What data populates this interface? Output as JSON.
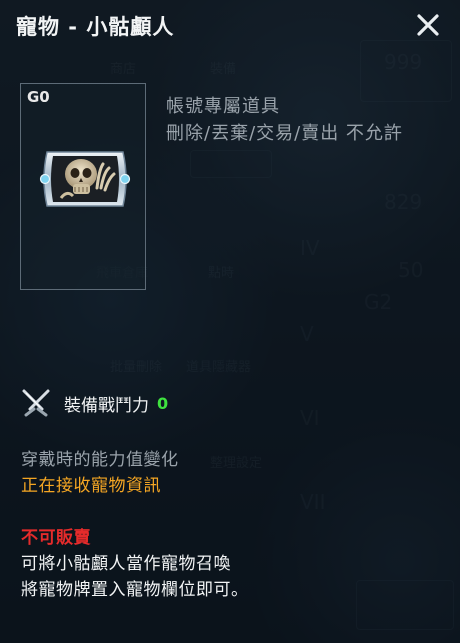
{
  "window": {
    "title": "寵物 - 小骷顱人",
    "close_icon": "close-icon"
  },
  "item": {
    "grade": "G0",
    "icon": "skull-pet-card-icon",
    "account_lines": [
      "帳號專屬道具",
      "刪除/丟棄/交易/賣出 不允許"
    ]
  },
  "stats": {
    "power_icon": "crossed-swords-icon",
    "power_label": "裝備戰鬥力",
    "power_value": "0"
  },
  "ability": {
    "title": "穿戴時的能力值變化",
    "status": "正在接收寵物資訊"
  },
  "notes": {
    "not_sellable": "不可販賣",
    "desc_lines": [
      "可將小骷顱人當作寵物召喚",
      "將寵物牌置入寵物欄位即可。"
    ]
  },
  "colors": {
    "power_value": "#3fe23f",
    "status": "#f5a623",
    "warning": "#e52b2b",
    "muted": "#9aa3ab"
  }
}
